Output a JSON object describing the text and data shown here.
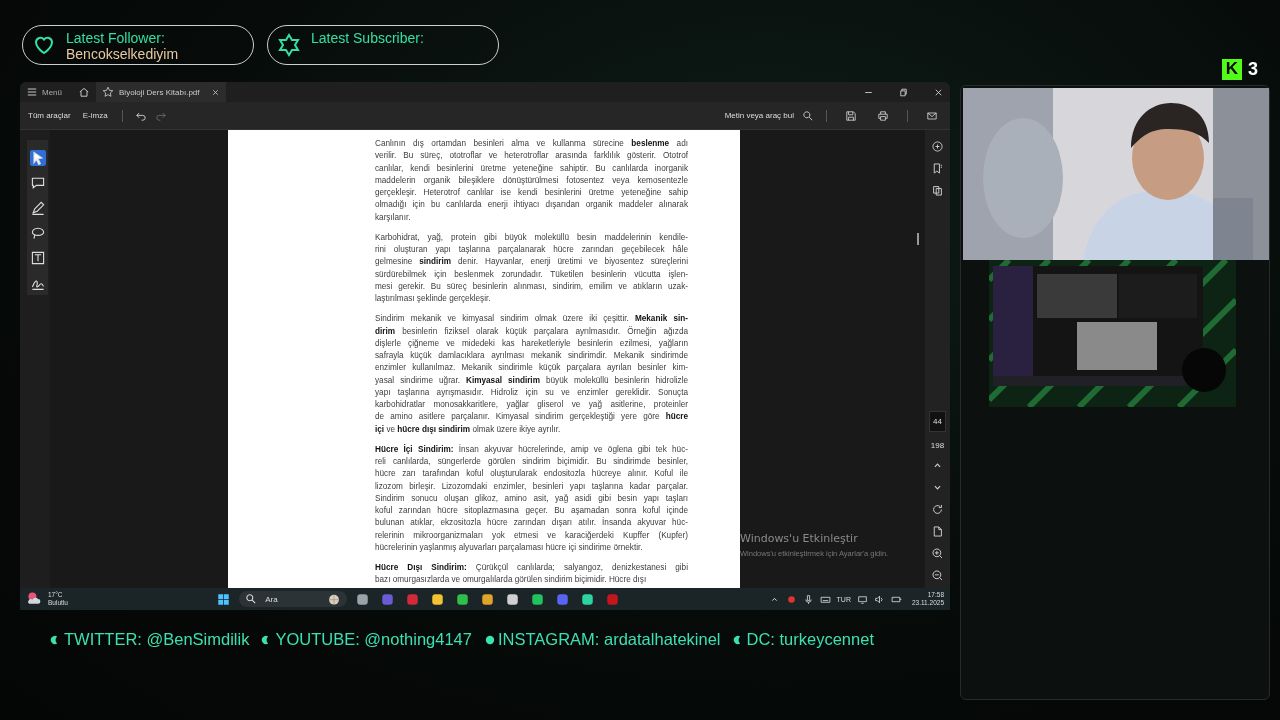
{
  "overlay": {
    "follower": {
      "label": "Latest Follower:",
      "name": "Bencokselkediyim"
    },
    "subscriber": {
      "label": "Latest Subscriber:"
    },
    "kick": {
      "logo": "K",
      "count": "3"
    },
    "socials": [
      {
        "kind": "crescent",
        "text": "TWITTER: @BenSimdilik"
      },
      {
        "kind": "crescent",
        "text": "YOUTUBE: @nothing4147"
      },
      {
        "kind": "dot",
        "text": "INSTAGRAM: ardatalhatekinel"
      },
      {
        "kind": "crescent",
        "text": "DC: turkeycennet"
      }
    ]
  },
  "pdf_window": {
    "menu": "Menü",
    "tabs": [
      {
        "label": "Biyoloji Ders Kitabı.pdf",
        "selected": true
      }
    ],
    "toolbar": {
      "buttons": [
        "Tüm araçlar",
        "E-imza"
      ],
      "search": "Metin veya araç bul"
    },
    "tools": [
      {
        "selected": true
      },
      {
        "selected": false
      },
      {
        "selected": false
      },
      {
        "selected": false
      },
      {
        "selected": false
      },
      {
        "selected": false
      }
    ],
    "page": {
      "current": "44",
      "total": "198"
    },
    "paragraphs": [
      [
        "Canlının dış ortamdan besinleri alma ve kullanma sürecine **beslenme** adı",
        "verilir. Bu süreç, ototroflar ve heterotroflar arasında farklılık gösterir. Ototrof",
        "canlılar, kendi besinlerini üretme yeteneğine sahiptir. Bu canlılarda inorganik",
        "maddelerin organik bileşiklere dönüştürülmesi fotosentez veya kemosentezle",
        "gerçekleşir. Heterotrof canlılar ise kendi besinlerini üretme yeteneğine sahip",
        "olmadığı için bu canlılarda enerji ihtiyacı dışarıdan organik maddeler alınarak",
        "karşılanır."
      ],
      [
        "Karbohidrat, yağ, protein gibi büyük moleküllü besin maddelerinin kendile-",
        "rini oluşturan yapı taşlarına parçalanarak hücre zarından geçebilecek hâle",
        "gelmesine **sindirim** denir. Hayvanlar, enerji üretimi ve biyosentez süreçlerini",
        "sürdürebilmek için beslenmek zorundadır. Tüketilen besinlerin vücutta işlen-",
        "mesi gerekir. Bu süreç besinlerin alınması, sindirim, emilim ve atıkların uzak-",
        "laştırılması şeklinde gerçekleşir."
      ],
      [
        "Sindirim mekanik ve kimyasal sindirim olmak üzere iki çeşittir. **Mekanik sin-**",
        "**dirim** besinlerin fiziksel olarak küçük parçalara ayrılmasıdır. Örneğin ağızda",
        "dişlerle çiğneme ve midedeki kas hareketleriyle besinlerin ezilmesi, yağların",
        "safrayla küçük damlacıklara ayrılması mekanik sindirimdir. Mekanik sindirimde",
        "enzimler kullanılmaz. Mekanik sindirimle küçük parçalara ayrılan besinler kim-",
        "yasal sindirime uğrar. **Kimyasal sindirim** büyük moleküllü besinlerin hidrolizle",
        "yapı taşlarına ayrışmasıdır. Hidroliz için su ve enzimler gereklidir. Sonuçta",
        "karbohidratlar monosakkaritlere, yağlar gliserol ve yağ asitlerine, proteinler",
        "de amino asitlere parçalanır. Kimyasal sindirim gerçekleştiği yere göre **hücre**",
        "**içi** ve **hücre dışı sindirim** olmak üzere ikiye ayrılır."
      ],
      [
        "**Hücre İçi Sindirim:** İnsan akyuvar hücrelerinde, amip ve öglena gibi tek hüc-",
        "reli canlılarda, süngerlerde görülen sindirim biçimidir. Bu sindirimde besinler,",
        "hücre zarı tarafından koful oluşturularak endositozla hücreye alınır. Koful ile",
        "lizozom birleşir. Lizozomdaki enzimler, besinleri yapı taşlarına kadar parçalar.",
        "Sindirim sonucu oluşan glikoz, amino asit, yağ asidi gibi besin yapı taşları",
        "koful zarından hücre sitoplazmasına geçer. Bu aşamadan sonra koful içinde",
        "bulunan atıklar, ekzositozla hücre zarından dışarı atılır. İnsanda akyuvar hüc-",
        "relerinin mikroorganizmaları yok etmesi ve karaciğerdeki Kupffer (Kupfer)",
        "hücrelerinin yaşlanmış alyuvarları parçalaması hücre içi sindirime örnektir."
      ],
      [
        "**Hücre Dışı Sindirim:** Çürükçül canlılarda; salyangoz, denizkestanesi gibi",
        "bazı omurgasızlarda ve omurgalılarda görülen sindirim biçimidir. Hücre dışı"
      ]
    ],
    "activation": {
      "title": "Windows'u Etkinleştir",
      "text": "Windows'u etkinleştirmek için Ayarlar'a gidin."
    }
  },
  "taskbar": {
    "temperature": "17°C",
    "weather": "Bulutlu",
    "search": "Ara",
    "language": "TUR",
    "time": "17:58",
    "date": "23.11.2025"
  }
}
